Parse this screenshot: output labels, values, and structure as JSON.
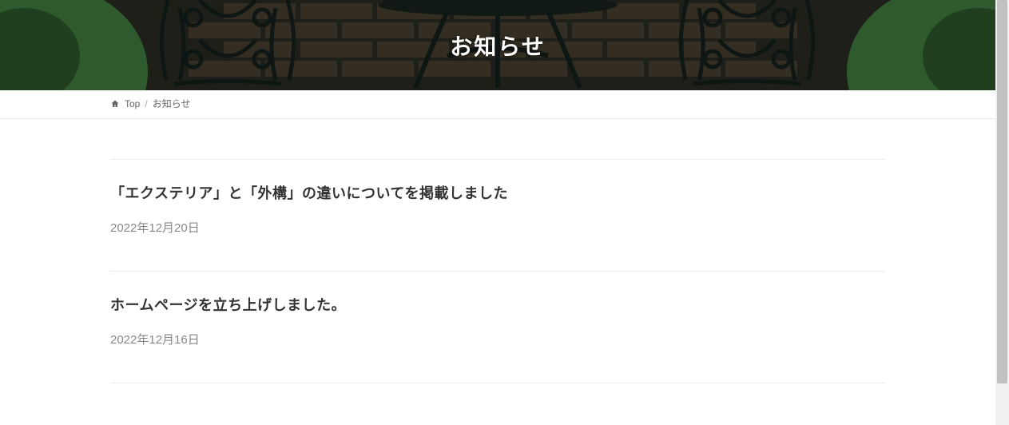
{
  "hero": {
    "title": "お知らせ"
  },
  "breadcrumb": {
    "home_label": "Top",
    "separator": "/",
    "current": "お知らせ"
  },
  "posts": [
    {
      "title": "「エクステリア」と「外構」の違いについてを掲載しました",
      "date": "2022年12月20日"
    },
    {
      "title": "ホームページを立ち上げしました。",
      "date": "2022年12月16日"
    }
  ]
}
